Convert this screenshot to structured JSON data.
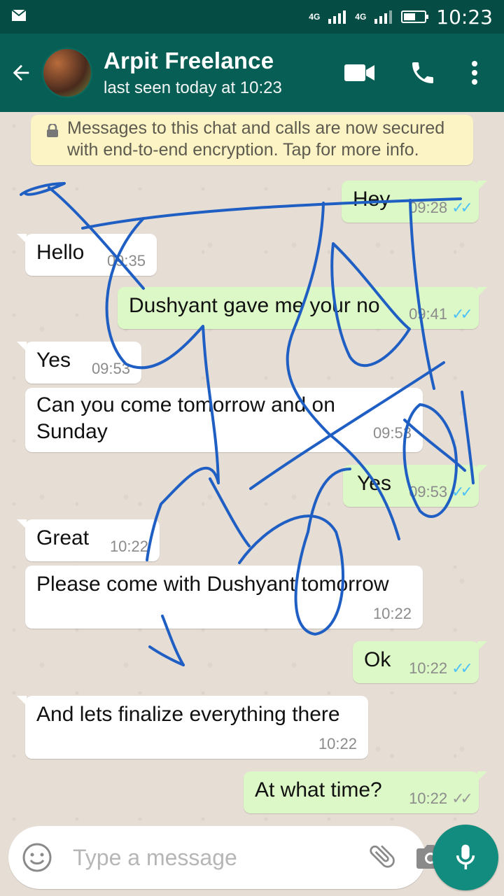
{
  "status_bar": {
    "network_1": "4G",
    "network_2": "4G",
    "time": "10:23"
  },
  "header": {
    "contact_name": "Arpit Freelance",
    "last_seen": "last seen today at 10:23",
    "icons": [
      "back-arrow-icon",
      "video-call-icon",
      "phone-icon",
      "more-vert-icon"
    ],
    "color": "#075e54"
  },
  "encryption_notice": "Messages to this chat and calls are now secured with end-to-end encryption. Tap for more info.",
  "messages": [
    {
      "direction": "out",
      "text": "Hey",
      "time": "09:28",
      "ticks": "✓✓"
    },
    {
      "direction": "in",
      "text": "Hello",
      "time": "09:35"
    },
    {
      "direction": "out",
      "text": "Dushyant gave me your no",
      "time": "09:41",
      "ticks": "✓✓"
    },
    {
      "direction": "in",
      "text": "Yes",
      "time": "09:53"
    },
    {
      "direction": "in",
      "text": "Can you come tomorrow and on Sunday",
      "time": "09:53"
    },
    {
      "direction": "out",
      "text": "Yes",
      "time": "09:53",
      "ticks": "✓✓"
    },
    {
      "direction": "in",
      "text": "Great",
      "time": "10:22"
    },
    {
      "direction": "in",
      "text": "Please come with Dushyant tomorrow",
      "time": "10:22"
    },
    {
      "direction": "out",
      "text": "Ok",
      "time": "10:22",
      "ticks": "✓✓"
    },
    {
      "direction": "in",
      "text": "And lets finalize everything there",
      "time": "10:22"
    },
    {
      "direction": "out",
      "text": "At what time?",
      "time": "10:22",
      "ticks": "✓✓"
    }
  ],
  "composer": {
    "placeholder": "Type a message",
    "icons": [
      "emoji-icon",
      "attach-icon",
      "camera-icon",
      "mic-icon"
    ]
  },
  "colors": {
    "accent": "#128c7e",
    "incoming": "#ffffff",
    "outgoing": "#dcf8c6",
    "read_ticks": "#4fc3f7",
    "scribble": "#1f5fc4"
  }
}
